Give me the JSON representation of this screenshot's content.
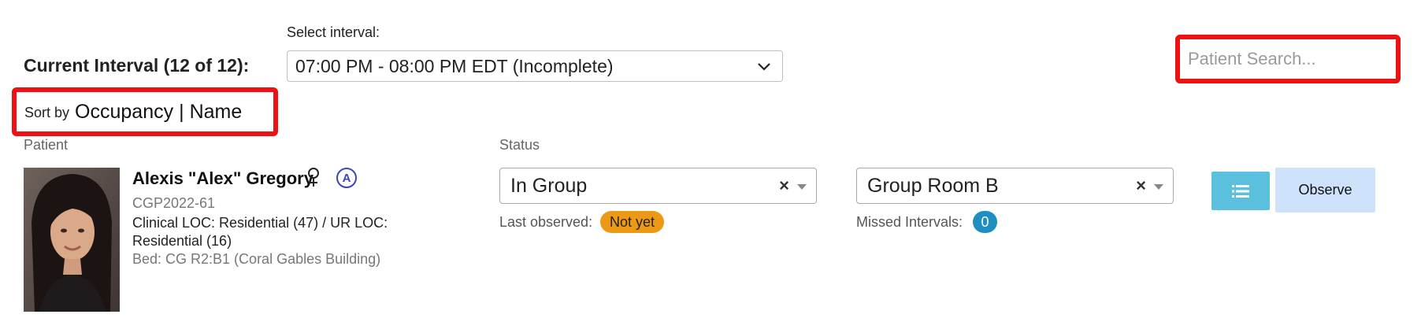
{
  "interval": {
    "select_label": "Select interval:",
    "current_label": "Current Interval (12 of 12):",
    "selected_value": "07:00 PM - 08:00 PM EDT (Incomplete)"
  },
  "search": {
    "placeholder": "Patient Search..."
  },
  "sort": {
    "prefix": "Sort by",
    "options": [
      "Occupancy",
      "Name"
    ],
    "separator": "|"
  },
  "columns": {
    "patient": "Patient",
    "status": "Status"
  },
  "patient": {
    "name": "Alexis \"Alex\" Gregory",
    "gender_icon": "female-icon",
    "acuity_badge": "A",
    "id": "CGP2022-61",
    "loc": "Clinical LOC: Residential (47) / UR LOC: Residential (16)",
    "bed": "Bed: CG R2:B1 (Coral Gables Building)",
    "status": "In Group",
    "last_observed_label": "Last observed:",
    "last_observed_value": "Not yet",
    "location": "Group Room B",
    "missed_intervals_label": "Missed Intervals:",
    "missed_intervals_value": "0"
  },
  "actions": {
    "list_icon": "list-icon",
    "observe_label": "Observe"
  },
  "colors": {
    "highlight_border": "#ee1111",
    "badge_orange": "#ec9a16",
    "badge_blue": "#1f8fc1",
    "list_button": "#5bc0de",
    "observe_button": "#cfe2fc"
  }
}
